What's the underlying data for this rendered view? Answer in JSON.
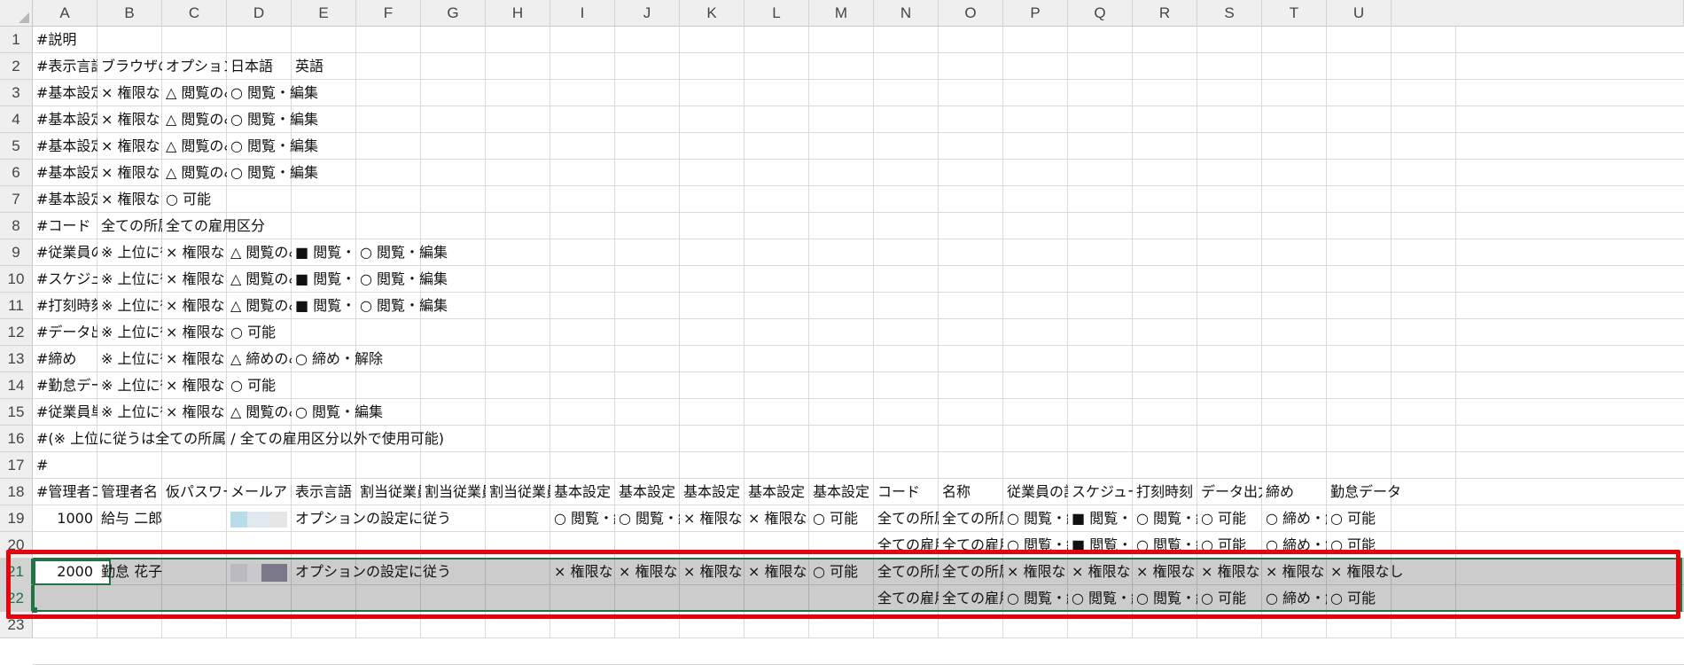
{
  "columns": [
    "A",
    "B",
    "C",
    "D",
    "E",
    "F",
    "G",
    "H",
    "I",
    "J",
    "K",
    "L",
    "M",
    "N",
    "O",
    "P",
    "Q",
    "R",
    "S",
    "T",
    "U"
  ],
  "rows": [
    "1",
    "2",
    "3",
    "4",
    "5",
    "6",
    "7",
    "8",
    "9",
    "10",
    "11",
    "12",
    "13",
    "14",
    "15",
    "16",
    "17",
    "18",
    "19",
    "20",
    "21",
    "22",
    "23"
  ],
  "cells": {
    "r1": {
      "A": "#説明"
    },
    "r2": {
      "A": "#表示言語",
      "B": "ブラウザの",
      "C": "オプション",
      "D": "日本語",
      "E": "英語"
    },
    "r3": {
      "A": "#基本設定",
      "B": "× 権限なし",
      "C": "△ 閲覧のみ",
      "D": "○ 閲覧・編集"
    },
    "r4": {
      "A": "#基本設定",
      "B": "× 権限なし",
      "C": "△ 閲覧のみ",
      "D": "○ 閲覧・編集"
    },
    "r5": {
      "A": "#基本設定",
      "B": "× 権限なし",
      "C": "△ 閲覧のみ",
      "D": "○ 閲覧・編集"
    },
    "r6": {
      "A": "#基本設定",
      "B": "× 権限なし",
      "C": "△ 閲覧のみ",
      "D": "○ 閲覧・編集"
    },
    "r7": {
      "A": "#基本設定",
      "B": "× 権限なし",
      "C": "○ 可能"
    },
    "r8": {
      "A": "#コード",
      "B": "全ての所属",
      "C": "全ての雇用区分"
    },
    "r9": {
      "A": "#従業員の",
      "B": "※ 上位に従",
      "C": "× 権限なし",
      "D": "△ 閲覧のみ",
      "E": "■ 閲覧・編",
      "F": "○ 閲覧・編集"
    },
    "r10": {
      "A": "#スケジュ",
      "B": "※ 上位に従",
      "C": "× 権限なし",
      "D": "△ 閲覧のみ",
      "E": "■ 閲覧・編",
      "F": "○ 閲覧・編集"
    },
    "r11": {
      "A": "#打刻時刻",
      "B": "※ 上位に従",
      "C": "× 権限なし",
      "D": "△ 閲覧のみ",
      "E": "■ 閲覧・編",
      "F": "○ 閲覧・編集"
    },
    "r12": {
      "A": "#データ出",
      "B": "※ 上位に従",
      "C": "× 権限なし",
      "D": "○ 可能"
    },
    "r13": {
      "A": "#締め",
      "B": "※ 上位に従",
      "C": "× 権限なし",
      "D": "△ 締めのみ",
      "E": "○ 締め・解除"
    },
    "r14": {
      "A": "#勤怠デー",
      "B": "※ 上位に従",
      "C": "× 権限なし",
      "D": "○ 可能"
    },
    "r15": {
      "A": "#従業員単",
      "B": "※ 上位に従",
      "C": "× 権限なし",
      "D": "△ 閲覧のみ",
      "E": "○ 閲覧・編集"
    },
    "r16": {
      "A": "#(※ 上位に従うは全ての所属 / 全ての雇用区分以外で使用可能)"
    },
    "r17": {
      "A": "#"
    },
    "r18": {
      "A": "#管理者コ",
      "B": "管理者名",
      "C": "仮パスワー",
      "D": "メールアド",
      "E": "表示言語",
      "F": "割当従業員",
      "G": "割当従業員",
      "H": "割当従業員",
      "I": "基本設定 -",
      "J": "基本設定 -",
      "K": "基本設定 -",
      "L": "基本設定 -",
      "M": "基本設定 -",
      "N": "コード",
      "O": "名称",
      "P": "従業員の設",
      "Q": "スケジュー",
      "R": "打刻時刻",
      "S": "データ出力",
      "T": "締め",
      "U": "勤怠データ"
    },
    "r19": {
      "A": "1000",
      "B": "給与 二郎",
      "E": "オプションの設定に従う",
      "I": "○ 閲覧・編",
      "J": "○ 閲覧・編",
      "K": "× 権限なし",
      "L": "× 権限なし",
      "M": "○ 可能",
      "N": "全ての所属",
      "O": "全ての所属",
      "P": "○ 閲覧・編",
      "Q": "■ 閲覧・編",
      "R": "○ 閲覧・編",
      "S": "○ 可能",
      "T": "○ 締め・解",
      "U": "○ 可能"
    },
    "r20": {
      "N": "全ての雇用",
      "O": "全ての雇用",
      "P": "○ 閲覧・編",
      "Q": "■ 閲覧・編",
      "R": "○ 閲覧・編",
      "S": "○ 可能",
      "T": "○ 締め・解",
      "U": "○ 可能"
    },
    "r21": {
      "A": "2000",
      "B": "勤怠 花子",
      "E": "オプションの設定に従う",
      "I": "× 権限なし",
      "J": "× 権限なし",
      "K": "× 権限なし",
      "L": "× 権限なし",
      "M": "○ 可能",
      "N": "全ての所属",
      "O": "全ての所属",
      "P": "× 権限なし",
      "Q": "× 権限なし",
      "R": "× 権限なし",
      "S": "× 権限なし",
      "T": "× 権限なし",
      "U": "× 権限なし"
    },
    "r22": {
      "N": "全ての雇用",
      "O": "全ての雇用",
      "P": "○ 閲覧・編",
      "Q": "○ 閲覧・編",
      "R": "○ 閲覧・編",
      "S": "○ 可能",
      "T": "○ 締め・解",
      "U": "○ 可能"
    }
  },
  "selection": {
    "active_cell": "A21",
    "range": "A21:U22"
  },
  "colors": {
    "selection_border": "#217346",
    "highlight_box": "#e8000a",
    "header_bg": "#efefef"
  }
}
